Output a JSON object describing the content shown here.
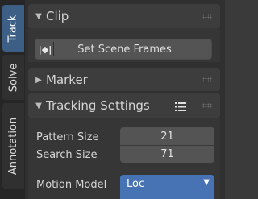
{
  "tabs": [
    {
      "label": "Track",
      "active": true
    },
    {
      "label": "Solve",
      "active": false
    },
    {
      "label": "Annotation",
      "active": false
    }
  ],
  "panels": {
    "clip": {
      "title": "Clip",
      "expanded": true,
      "button_label": "Set Scene Frames",
      "button_icon": "set-frames-icon"
    },
    "marker": {
      "title": "Marker",
      "expanded": false
    },
    "tracking_settings": {
      "title": "Tracking Settings",
      "expanded": true,
      "pattern_size_label": "Pattern Size",
      "pattern_size_value": "21",
      "search_size_label": "Search Size",
      "search_size_value": "71",
      "motion_model_label": "Motion Model",
      "motion_model_value": "Loc"
    }
  },
  "colors": {
    "accent": "#4772b3",
    "active_tab": "#3d5f86",
    "panel_bg": "#303030"
  }
}
